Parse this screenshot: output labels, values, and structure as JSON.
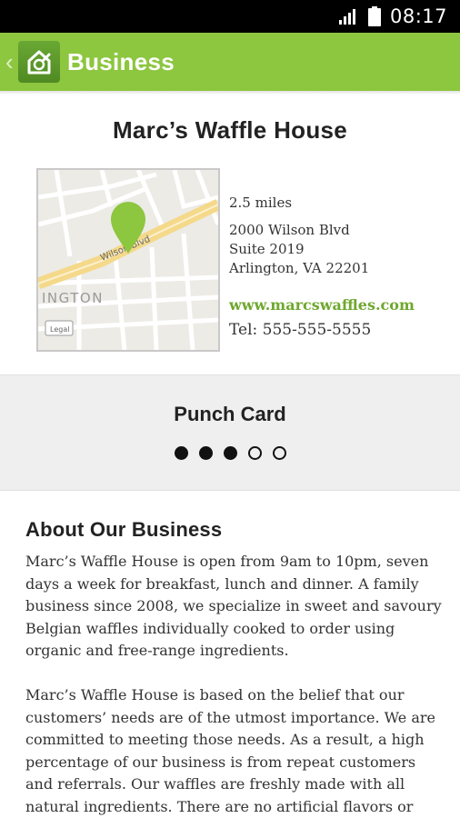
{
  "status_bar": {
    "time": "08:17",
    "signal_icon": "signal-icon",
    "battery_icon": "battery-icon"
  },
  "app_bar": {
    "title": "Business",
    "back_icon": "chevron-left-icon",
    "logo_icon": "house-logo-icon"
  },
  "business": {
    "name": "Marc’s Waffle House",
    "distance": "2.5 miles",
    "address_line1": "2000 Wilson Blvd",
    "address_line2": "Suite 2019",
    "address_line3": "Arlington, VA 22201",
    "website": "www.marcswaffles.com",
    "phone": "Tel: 555-555-5555"
  },
  "map": {
    "labels": {
      "street": "Wilson Blvd",
      "area": "INGTON",
      "corner": "Legal"
    },
    "pin_icon": "map-pin-icon"
  },
  "punch_card": {
    "title": "Punch Card",
    "total": 5,
    "filled": 3
  },
  "about": {
    "title": "About Our Business",
    "paragraph1": "Marc’s Waffle House is open from 9am to 10pm, seven days a week for breakfast, lunch and dinner. A family business since 2008, we specialize in sweet and savoury Belgian waffles individually cooked to order using organic and free-range ingredients.",
    "paragraph2": "Marc’s Waffle House is based on the belief that our customers’ needs are of the utmost importance. We are committed to meeting those needs. As a result, a high percentage of our business is from repeat customers and referrals. Our waffles are freshly made with all natural ingredients. There are no artificial flavors or"
  },
  "colors": {
    "accent": "#8dc63f",
    "link": "#6fa82e"
  }
}
